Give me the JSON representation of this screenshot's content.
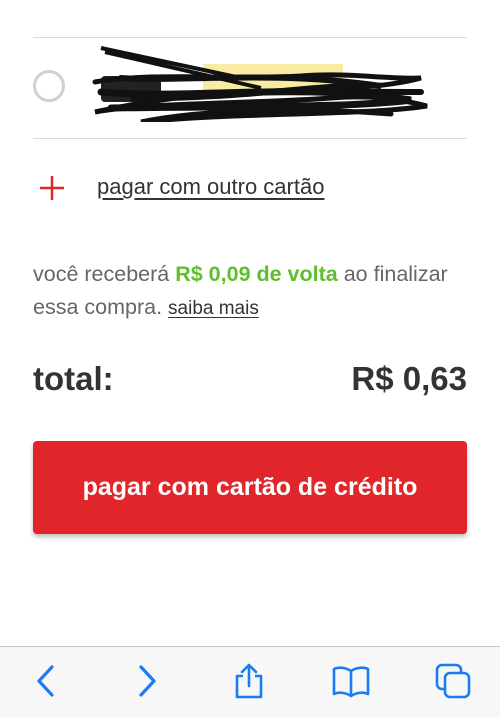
{
  "payment": {
    "add_card_label": "pagar com outro cartão",
    "cashback_prefix": "você receberá ",
    "cashback_amount": "R$ 0,09 de volta",
    "cashback_suffix": " ao finalizar essa compra. ",
    "learn_more_label": "saiba mais",
    "total_label": "total:",
    "total_value": "R$ 0,63",
    "pay_button_label": "pagar com cartão de crédito"
  },
  "toolbar": {
    "icons": [
      "back-icon",
      "forward-icon",
      "share-icon",
      "bookmarks-icon",
      "tabs-icon"
    ]
  },
  "colors": {
    "accent_red": "#e0262b",
    "cashback_green": "#5dbf2c",
    "ios_blue": "#1a7cf5"
  }
}
